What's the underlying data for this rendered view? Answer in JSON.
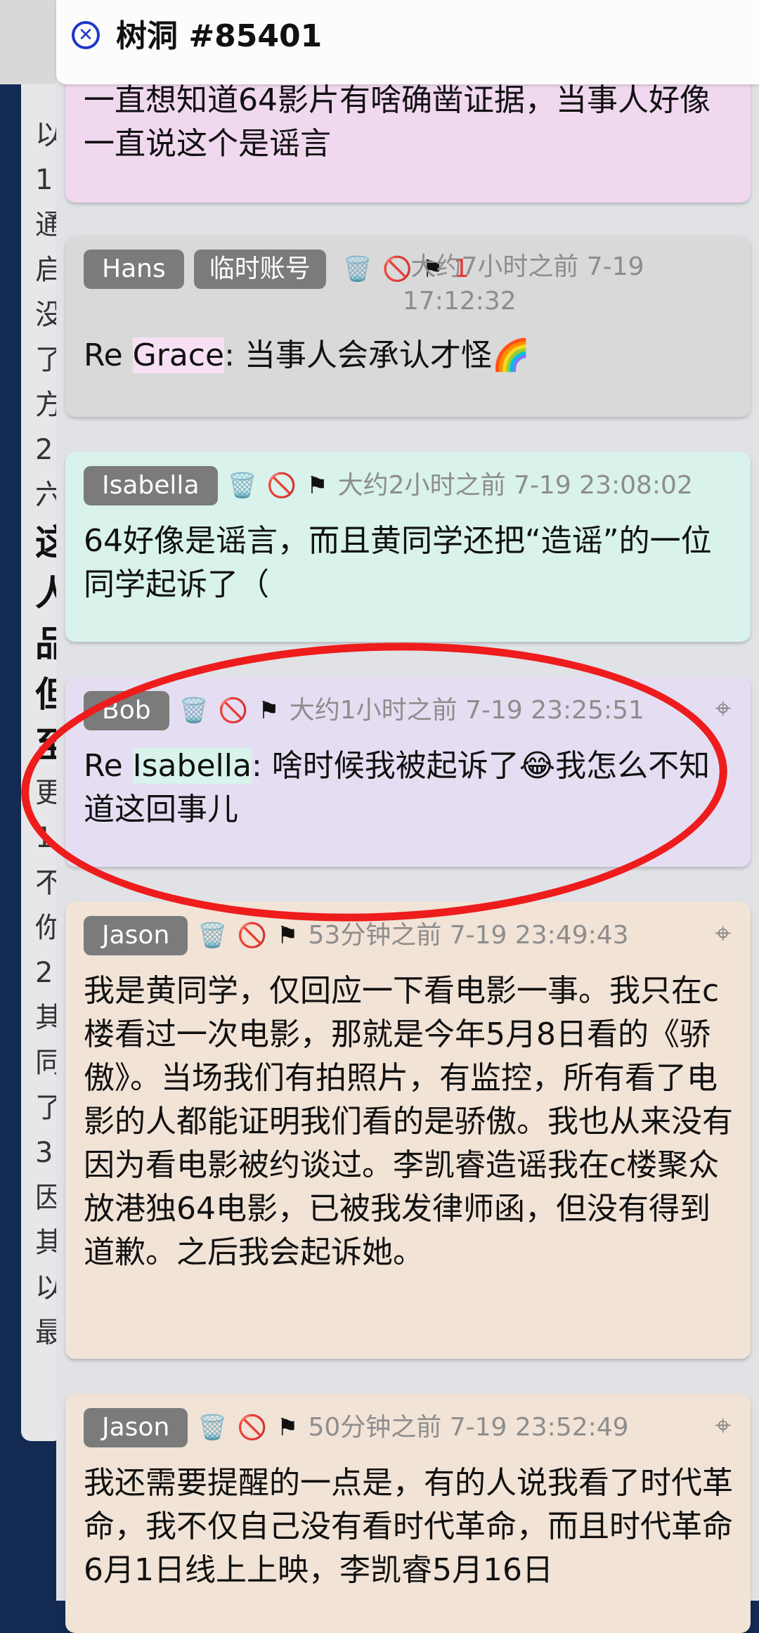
{
  "header": {
    "title": "树洞 #85401",
    "close_icon": "close-circle-icon"
  },
  "background": {
    "chars": [
      "以",
      "1",
      "通",
      "启",
      "没",
      "了",
      "方",
      "2",
      "六"
    ],
    "bold_chars": [
      "这",
      "人",
      "品",
      "但",
      "至"
    ],
    "chars2": [
      "更",
      "1",
      "不",
      "你",
      "2",
      "其",
      "同",
      "了",
      "3",
      "因",
      "其",
      "以",
      "最"
    ]
  },
  "cards": [
    {
      "color": "#f0d8ef",
      "text": "一直想知道64影片有啥确凿证据，当事人好像一直说这个是谣言"
    },
    {
      "color": "#d9d9da",
      "name": "Hans",
      "tag": "临时账号",
      "count": "1",
      "time": "大约7小时之前 7-19 17:12:32",
      "reply_to": "Grace",
      "text": ": 当事人会承认才怪🌈"
    },
    {
      "color": "#d9f2ec",
      "name": "Isabella",
      "time": "大约2小时之前 7-19 23:08:02",
      "text": "64好像是谣言，而且黄同学还把“造谣”的一位同学起诉了（"
    },
    {
      "color": "#e5def2",
      "name": "Bob",
      "time": "大约1小时之前 7-19 23:25:51",
      "reply_to": "Isabella",
      "text": ": 啥时候我被起诉了😂我怎么不知道这回事儿"
    },
    {
      "color": "#f1e3d6",
      "name": "Jason",
      "time": "53分钟之前 7-19 23:49:43",
      "text": "我是黄同学，仅回应一下看电影一事。我只在c楼看过一次电影，那就是今年5月8日看的《骄傲》。当场我们有拍照片，有监控，所有看了电影的人都能证明我们看的是骄傲。我也从来没有因为看电影被约谈过。李凯睿造谣我在c楼聚众放港独64电影，已被我发律师函，但没有得到道歉。之后我会起诉她。"
    },
    {
      "color": "#f1e3d6",
      "name": "Jason",
      "time": "50分钟之前 7-19 23:52:49",
      "text": "我还需要提醒的一点是，有的人说我看了时代革命，我不仅自己没有看时代革命，而且时代革命6月1日线上上映，李凯睿5月16日"
    }
  ],
  "icons": {
    "trash": "🗑️",
    "block": "🚫",
    "flag": "⚑",
    "target": "⌖",
    "re": "Re "
  },
  "annotation_color": "#ee1c1c"
}
